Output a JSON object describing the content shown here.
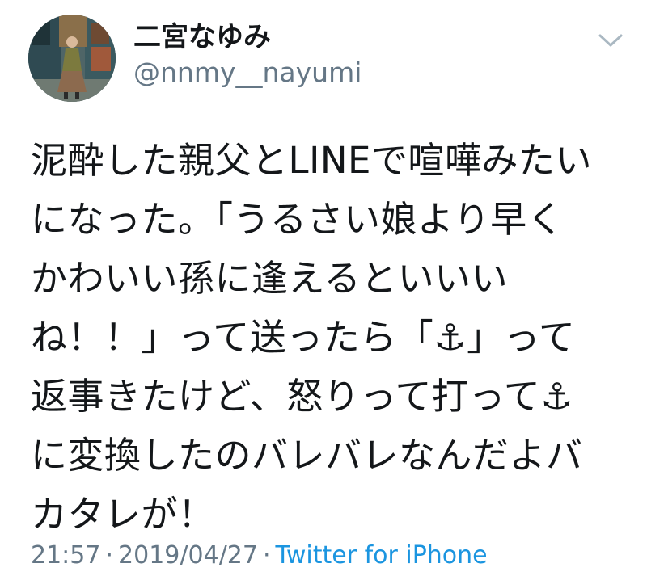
{
  "user": {
    "display_name": "二宮なゆみ",
    "handle": "@nnmy__nayumi"
  },
  "tweet": {
    "lines": [
      "泥酔した親父とLINEで喧嘩みたい",
      "になった。「うるさい娘より早く",
      "かわいい孫に逢えるといいい",
      "ね！！」って送ったら「⚓」って",
      "返事きたけど、怒りって打って⚓",
      "に変換したのバレバレなんだよバ",
      "カタレが！"
    ],
    "time": "21:57",
    "separator": "·",
    "date": "2019/04/27",
    "source": "Twitter for iPhone"
  },
  "icons": {
    "menu": "chevron-down-icon",
    "avatar": "avatar-photo"
  },
  "colors": {
    "text": "#14171a",
    "secondary": "#657786",
    "link": "#1b95e0",
    "chevron": "#aab8c2"
  }
}
